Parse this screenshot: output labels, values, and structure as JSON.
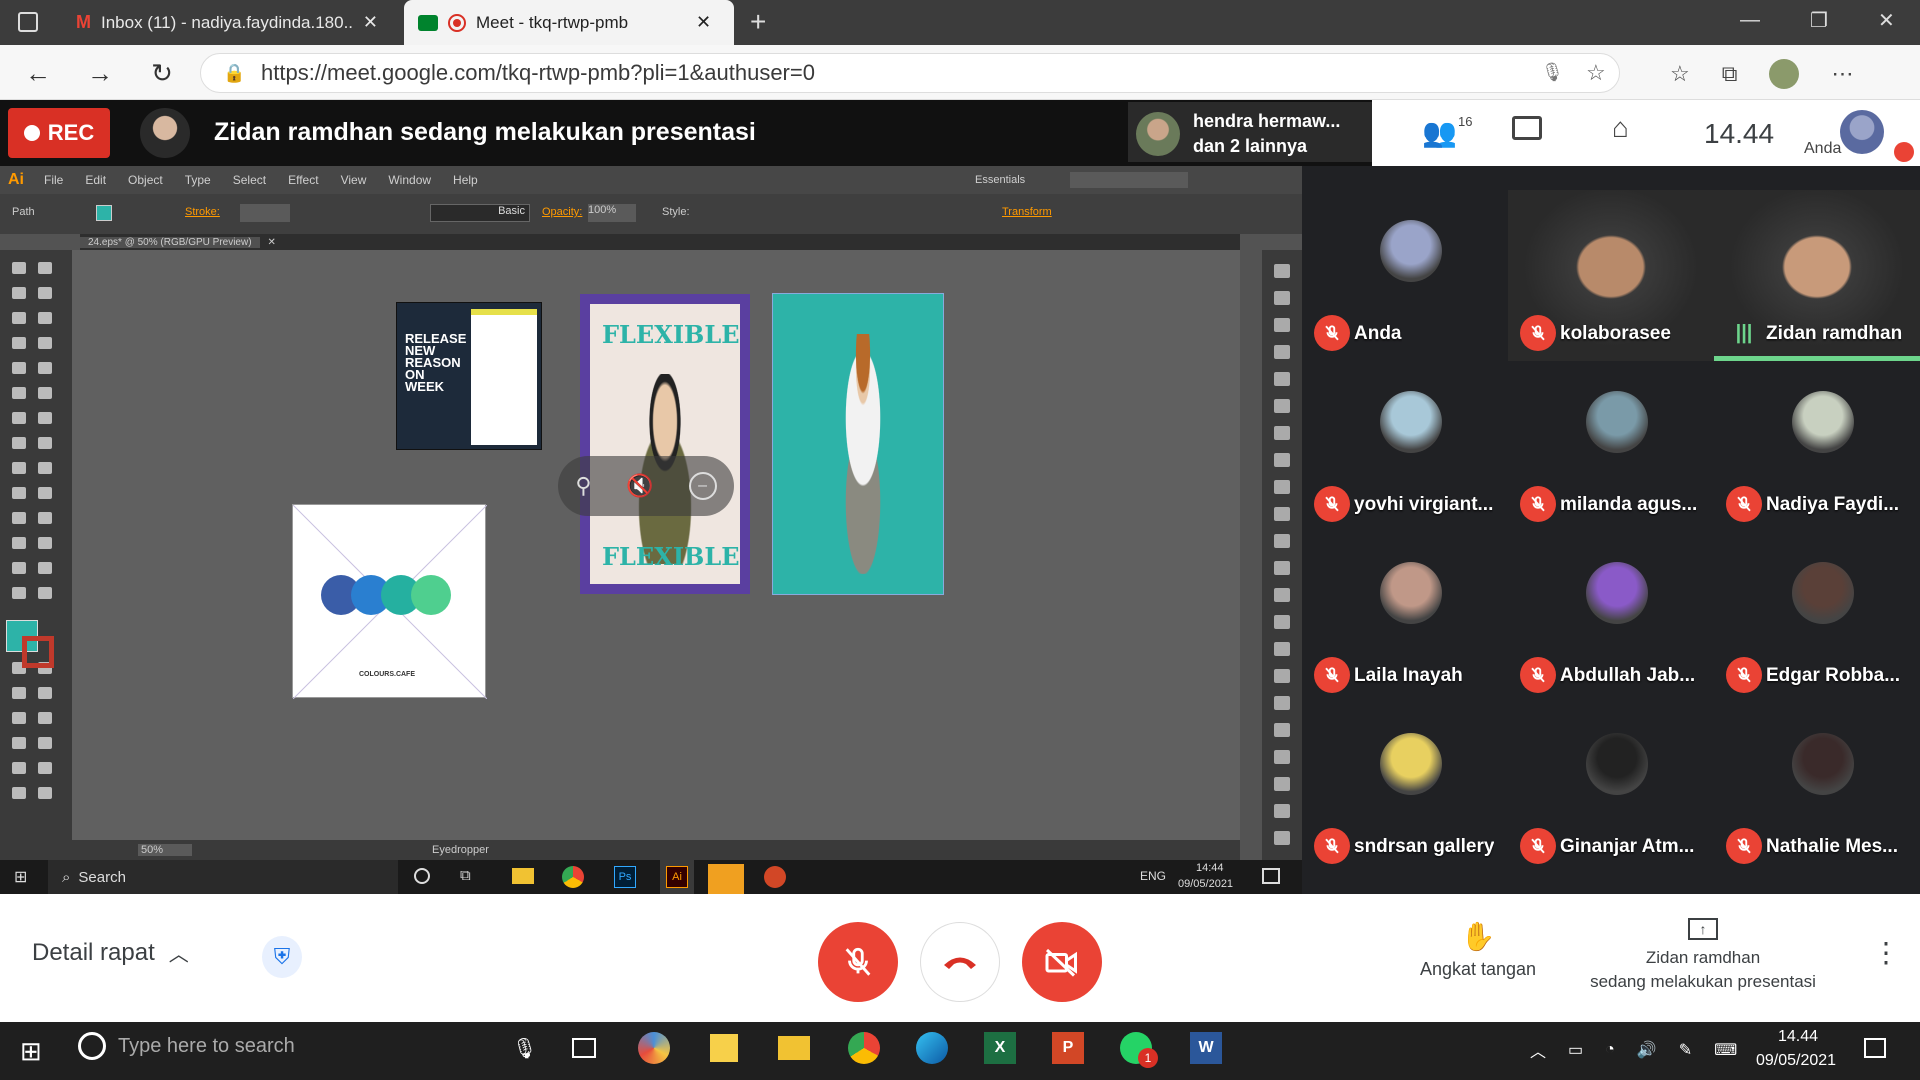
{
  "browser": {
    "tabs": [
      {
        "label": "Inbox (11) - nadiya.faydinda.180...",
        "icon": "gmail-icon"
      },
      {
        "label": "Meet - tkq-rtwp-pmb",
        "icon": "meet-icon",
        "active": true
      }
    ],
    "url": "https://meet.google.com/tkq-rtwp-pmb?pli=1&authuser=0"
  },
  "meet": {
    "rec_label": "REC",
    "presenting_text": "Zidan ramdhan sedang melakukan presentasi",
    "pinned_name": "hendra hermaw...",
    "pinned_sub": "dan 2 lainnya",
    "people_count": "16",
    "clock": "14.44",
    "self_label": "Anda"
  },
  "illustrator": {
    "logo": "Ai",
    "menu": [
      "File",
      "Edit",
      "Object",
      "Type",
      "Select",
      "Effect",
      "View",
      "Window",
      "Help"
    ],
    "workspace": "Essentials",
    "ctrl_path": "Path",
    "stroke_label": "Stroke:",
    "basic_label": "Basic",
    "opacity_label": "Opacity:",
    "opacity_value": "100%",
    "style_label": "Style:",
    "transform_label": "Transform",
    "doc_tab": "24.eps* @ 50% (RGB/GPU Preview)",
    "zoom": "50%",
    "status_tool": "Eyedropper",
    "artboard1_text": "RELEASE NEW REASON ON WEEK",
    "artboard2_title": "FLEXIBLE",
    "artboard4_label": "COLOURS.CAFE",
    "swatch_colors": [
      "#3a5da8",
      "#2a7fd0",
      "#25b0a0",
      "#4fcf8f"
    ]
  },
  "inner_taskbar": {
    "search": "Search",
    "lang": "ENG",
    "time": "14:44",
    "date": "09/05/2021"
  },
  "participants": [
    {
      "name": "Anda",
      "muted": true,
      "type": "avatar"
    },
    {
      "name": "kolaborasee",
      "muted": true,
      "type": "video"
    },
    {
      "name": "Zidan ramdhan",
      "muted": false,
      "type": "video",
      "speaking": true
    },
    {
      "name": "yovhi virgiant...",
      "muted": true,
      "type": "avatar"
    },
    {
      "name": "milanda agus...",
      "muted": true,
      "type": "avatar"
    },
    {
      "name": "Nadiya Faydi...",
      "muted": true,
      "type": "avatar"
    },
    {
      "name": "Laila Inayah",
      "muted": true,
      "type": "avatar"
    },
    {
      "name": "Abdullah Jab...",
      "muted": true,
      "type": "avatar"
    },
    {
      "name": "Edgar Robba...",
      "muted": true,
      "type": "avatar"
    },
    {
      "name": "sndrsan gallery",
      "muted": true,
      "type": "avatar"
    },
    {
      "name": "Ginanjar Atm...",
      "muted": true,
      "type": "avatar"
    },
    {
      "name": "Nathalie Mes...",
      "muted": true,
      "type": "avatar"
    }
  ],
  "bottom": {
    "details": "Detail rapat",
    "raise_hand": "Angkat tangan",
    "present_line1": "Zidan ramdhan",
    "present_line2": "sedang melakukan presentasi"
  },
  "taskbar": {
    "search_placeholder": "Type here to search",
    "time": "14.44",
    "date": "09/05/2021",
    "whatsapp_badge": "1"
  },
  "colors": {
    "rec": "#d93025",
    "muted": "#ea4335",
    "accent": "#1a73e8",
    "teal": "#2db3a8"
  }
}
